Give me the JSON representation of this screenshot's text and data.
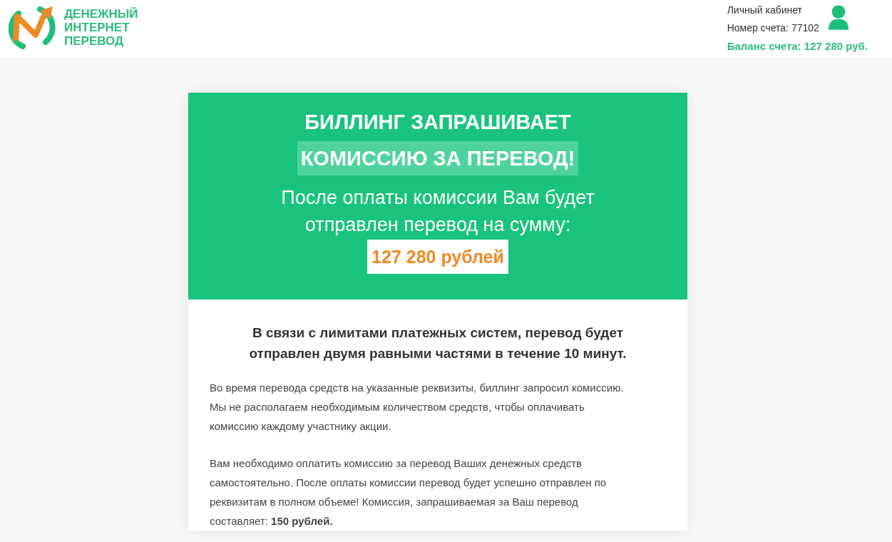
{
  "header": {
    "logo_text": [
      "ДЕНЕЖНЫЙ",
      "ИНТЕРНЕТ",
      "ПЕРЕВОД"
    ],
    "account_link": "Личный кабинет",
    "account_number": "Номер счета: 77102",
    "balance": "Баланс счета: 127 280 руб."
  },
  "banner": {
    "title": "БИЛЛИНГ ЗАПРАШИВАЕТ",
    "highlight": "КОМИССИЮ ЗА ПЕРЕВОД!",
    "subtitle": "После оплаты комиссии Вам будет отправлен перевод на сумму:",
    "amount": "127 280 рублей"
  },
  "body": {
    "heading": "В связи с лимитами платежных систем, перевод будет отправлен двумя равными частями в течение 10 минут.",
    "paragraphs": [
      "Во время перевода средств на указанные реквизиты, биллинг запросил комиссию. Мы не располагаем необходимым количеством средств, чтобы оплачивать комиссию каждому участнику акции.",
      "Вам необходимо оплатить комиссию за перевод Ваших денежных средств самостоятельно. После оплаты комиссии перевод будет успешно отправлен по реквизитам в полном объеме! Комиссия, запрашиваемая за Ваш перевод составляет: **150 рублей.**"
    ]
  }
}
